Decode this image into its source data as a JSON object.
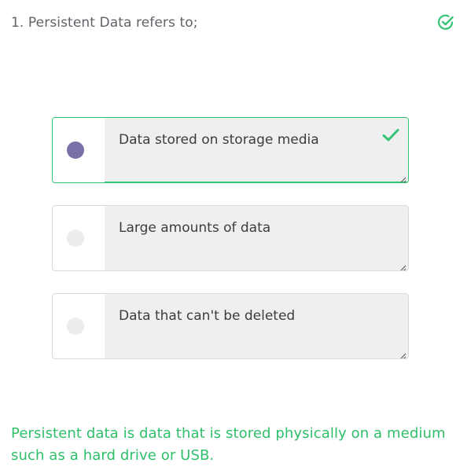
{
  "question": {
    "text": "1. Persistent Data refers to;",
    "status_icon": "check-circle-icon",
    "status_color": "#34c474"
  },
  "options": [
    {
      "label": "Data stored on storage media",
      "selected": true,
      "correct": true
    },
    {
      "label": "Large amounts of data",
      "selected": false,
      "correct": false
    },
    {
      "label": "Data that can't be deleted",
      "selected": false,
      "correct": false
    }
  ],
  "explanation": {
    "text": "Persistent data is data that is stored physically on a medium such as a hard drive or USB."
  },
  "colors": {
    "correct": "#34c474",
    "selected_radio": "#7b70a8",
    "unselected_radio": "#ececec",
    "option_background": "#efefef"
  }
}
